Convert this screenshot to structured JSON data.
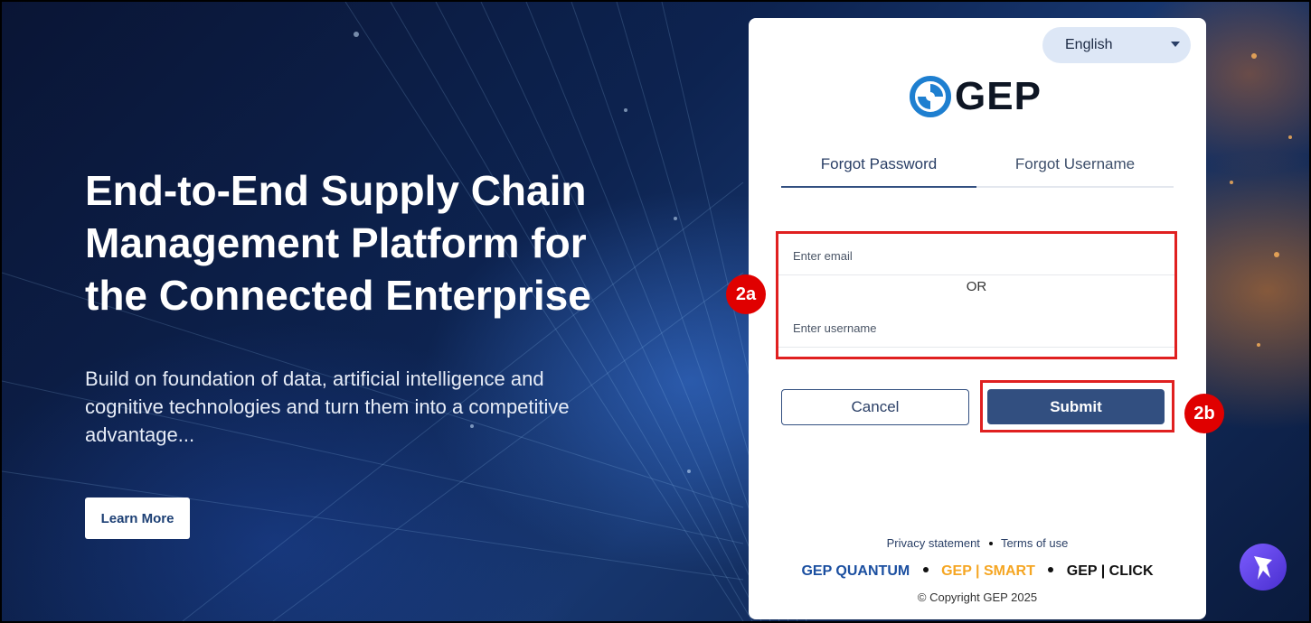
{
  "hero": {
    "title_lines": [
      "End-to-End Supply Chain",
      "Management Platform for",
      "the Connected Enterprise"
    ],
    "subtitle": "Build on foundation of data, artificial intelligence and cognitive technologies and turn them into a competitive advantage...",
    "learn_more_label": "Learn More"
  },
  "card": {
    "language": "English",
    "logo_text": "GEP",
    "tabs": [
      {
        "label": "Forgot Password",
        "active": true
      },
      {
        "label": "Forgot Username",
        "active": false
      }
    ],
    "email_placeholder": "Enter email",
    "or_label": "OR",
    "username_placeholder": "Enter username",
    "cancel_label": "Cancel",
    "submit_label": "Submit",
    "footer": {
      "privacy_label": "Privacy statement",
      "terms_label": "Terms of use",
      "brands": [
        "GEP QUANTUM",
        "GEP | SMART",
        "GEP | CLICK"
      ],
      "copyright": "© Copyright GEP 2025"
    }
  },
  "annotations": {
    "badge_a": "2a",
    "badge_b": "2b",
    "highlight_color": "#e02020"
  },
  "colors": {
    "primary": "#324f80",
    "badge": "#e00000"
  },
  "icons": [
    "gep-logo-icon",
    "chevron-down-icon",
    "assistant-icon"
  ]
}
